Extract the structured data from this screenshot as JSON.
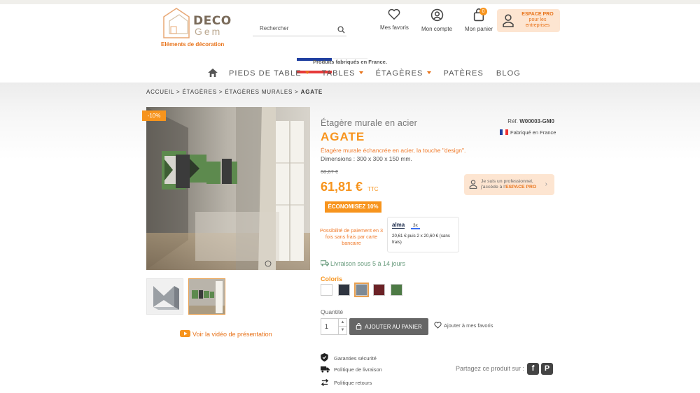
{
  "header": {
    "logo_name": "DECO",
    "logo_sub": "Gem",
    "tagline": "Eléments de décoration",
    "search_placeholder": "Rechercher",
    "links": {
      "favorites": "Mes favoris",
      "account": "Mon compte",
      "cart": "Mon panier",
      "cart_count": "0"
    },
    "pro": {
      "title": "ESPACE PRO",
      "line1": "pour les",
      "line2": "entreprises"
    },
    "made_in_france": "Produits fabriqués en France."
  },
  "nav": {
    "items": [
      {
        "label": "PIEDS DE TABLE",
        "has_dropdown": true
      },
      {
        "label": "TABLES",
        "has_dropdown": true
      },
      {
        "label": "ÉTAGÈRES",
        "has_dropdown": true
      },
      {
        "label": "PATÈRES",
        "has_dropdown": false
      },
      {
        "label": "BLOG",
        "has_dropdown": false
      }
    ]
  },
  "breadcrumb": {
    "items": [
      "ACCUEIL",
      "ÉTAGÈRES",
      "ÉTAGÈRES MURALES"
    ],
    "current": "AGATE",
    "sep": " > "
  },
  "product": {
    "discount_badge": "-10%",
    "subtitle": "Étagère murale en acier",
    "name": "AGATE",
    "ref_label": "Réf.",
    "ref": "W00003-GM0",
    "fabrique": "Fabriqué en France",
    "description": "Étagère murale échancrée en acier, la touche \"design\".",
    "dimensions": "Dimensions : 300 x 300 x 150 mm.",
    "old_price": "68,67 €",
    "price": "61,81 €",
    "price_suffix": "TTC",
    "economy": "ÉCONOMISEZ 10%",
    "pro_promo": {
      "line1": "Je suis un professionnel,",
      "line2_prefix": "j'accède à l'",
      "line2_link": "ESPACE PRO",
      "arrow": "›"
    },
    "payment_note": "Possibilité de paiement en 3 fois sans frais par carte bancaire",
    "alma": {
      "logo": "alma",
      "option": "3x",
      "description": "20,61 € puis 2 x 20,60 € (sans frais)"
    },
    "delivery": "Livraison sous 5 à 14 jours",
    "colors_label": "Coloris",
    "colors": [
      "#ffffff",
      "#2f3540",
      "#7d8a96",
      "#6b2226",
      "#4d7a45"
    ],
    "selected_color": 2,
    "quantity_label": "Quantité",
    "quantity": "1",
    "add_to_cart": "AJOUTER AU PANIER",
    "add_to_favorites": "Ajouter à mes favoris",
    "video_link": "Voir la vidéo de présentation",
    "guarantees": [
      "Garanties sécurité",
      "Politique de livraison",
      "Politique retours"
    ],
    "share_label": "Partagez ce produit sur :",
    "share_networks": [
      "facebook",
      "pinterest"
    ]
  },
  "colors": {
    "accent": "#f7941d",
    "accent_dark": "#e8731a",
    "delivery_green": "#6a9c7e",
    "flag": [
      "#1f3fa0",
      "#ffffff",
      "#e63a3a"
    ]
  }
}
